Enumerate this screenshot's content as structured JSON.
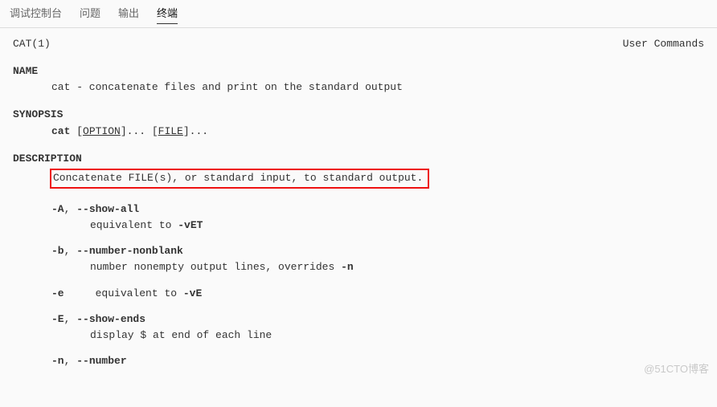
{
  "tabs": {
    "debug": "调试控制台",
    "problems": "问题",
    "output": "输出",
    "terminal": "终端"
  },
  "man": {
    "page": "CAT(1)",
    "category": "User Commands",
    "name": {
      "h": "NAME",
      "body": "cat - concatenate files and print on the standard output"
    },
    "syn": {
      "h": "SYNOPSIS",
      "cmd": "cat",
      "opt": "OPTION",
      "file": "FILE",
      "brl": " [",
      "brm": "]... [",
      "brr": "]..."
    },
    "desc": {
      "h": "DESCRIPTION",
      "lead": "Concatenate FILE(s), or standard input, to standard output.",
      "o1s": "-A",
      "o1c": ", ",
      "o1l": "--show-all",
      "o1dpre": "equivalent to ",
      "o1dflag": "-vET",
      "o2s": "-b",
      "o2c": ", ",
      "o2l": "--number-nonblank",
      "o2dpre": "number nonempty output lines, overrides ",
      "o2dflag": "-n",
      "o3s": "-e",
      "o3dpre": "equivalent to ",
      "o3dflag": "-vE",
      "o4s": "-E",
      "o4c": ", ",
      "o4l": "--show-ends",
      "o4d": "display $ at end of each line",
      "o5s": "-n",
      "o5c": ", ",
      "o5l": "--number"
    }
  },
  "watermark": "@51CTO博客"
}
